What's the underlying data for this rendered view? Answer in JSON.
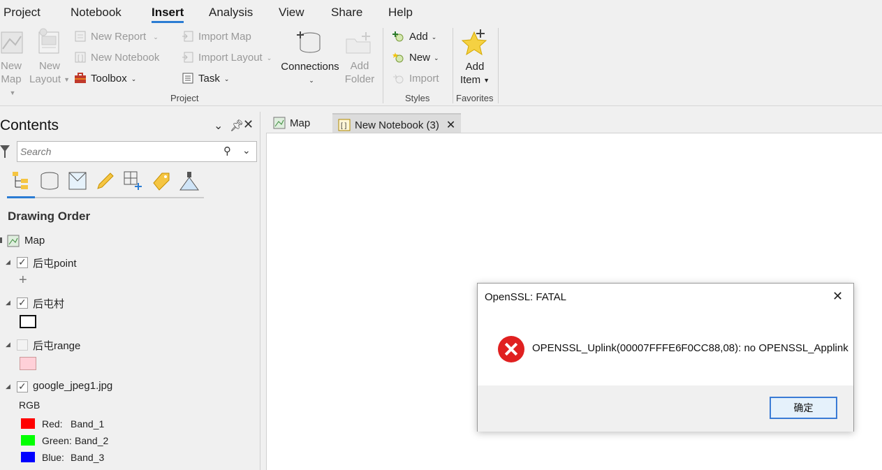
{
  "menu": {
    "tabs": [
      "Project",
      "Notebook",
      "Insert",
      "Analysis",
      "View",
      "Share",
      "Help"
    ],
    "active": "Insert"
  },
  "ribbon": {
    "project_group": {
      "new_map": [
        "New",
        "Map"
      ],
      "new_layout": [
        "New",
        "Layout"
      ],
      "new_report": "New Report",
      "new_notebook": "New Notebook",
      "toolbox": "Toolbox",
      "import_map": "Import Map",
      "import_layout": "Import Layout",
      "task": "Task",
      "connections": "Connections",
      "add_folder": [
        "Add",
        "Folder"
      ],
      "label": "Project"
    },
    "styles_group": {
      "add": "Add",
      "new": "New",
      "import": "Import",
      "label": "Styles"
    },
    "favorites_group": {
      "add_item": [
        "Add",
        "Item"
      ],
      "label": "Favorites"
    }
  },
  "contents": {
    "title": "Contents",
    "search_placeholder": "Search",
    "heading": "Drawing Order",
    "map_label": "Map",
    "layers": [
      {
        "name": "后屯point",
        "checked": true
      },
      {
        "name": "后屯村",
        "checked": true
      },
      {
        "name": "后屯range",
        "checked": false
      },
      {
        "name": "google_jpeg1.jpg",
        "checked": true
      }
    ],
    "rgb_label": "RGB",
    "bands": [
      {
        "label": "Red:",
        "band": "Band_1",
        "color": "#ff0000"
      },
      {
        "label": "Green:",
        "band": "Band_2",
        "color": "#00ff00"
      },
      {
        "label": "Blue:",
        "band": "Band_3",
        "color": "#0000ff"
      }
    ]
  },
  "doc_tabs": [
    {
      "label": "Map",
      "active": false
    },
    {
      "label": "New Notebook (3)",
      "active": true
    }
  ],
  "dialog": {
    "title": "OpenSSL: FATAL",
    "message": "OPENSSL_Uplink(00007FFFE6F0CC88,08): no OPENSSL_Applink",
    "ok": "确定"
  }
}
